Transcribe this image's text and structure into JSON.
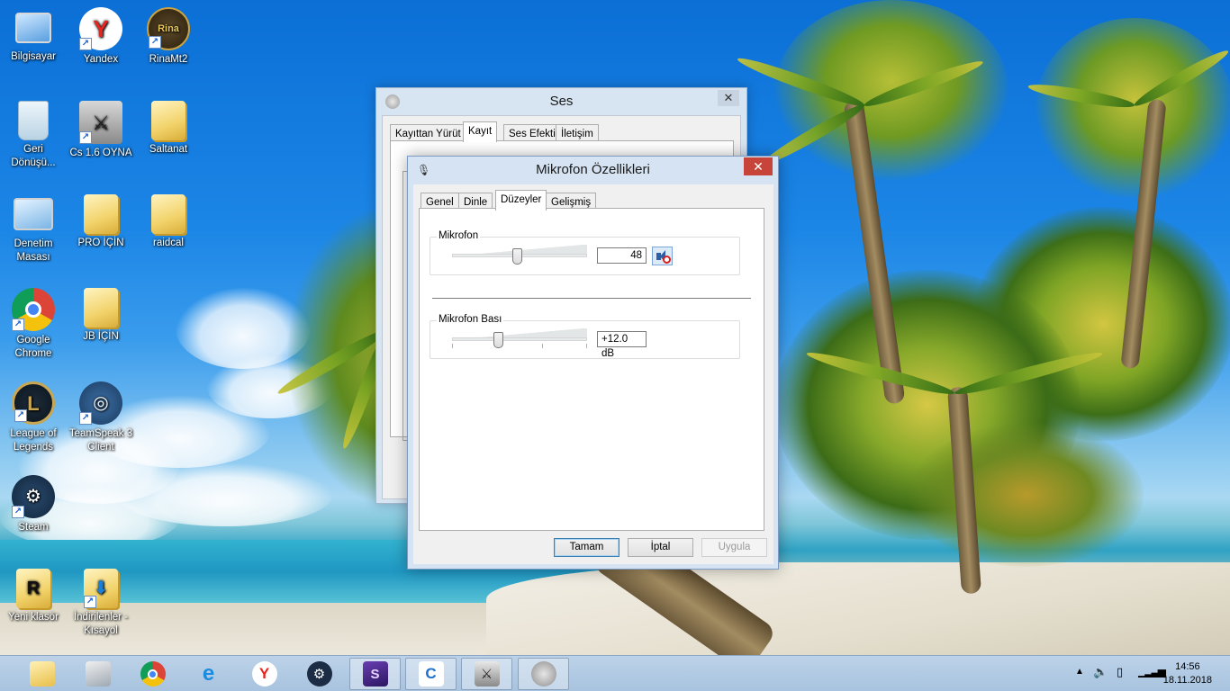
{
  "desktop": {
    "icons": [
      {
        "label": "Bilgisayar",
        "icon": "computer-icon"
      },
      {
        "label": "Yandex",
        "icon": "yandex-icon"
      },
      {
        "label": "RinaMt2",
        "icon": "rina-icon",
        "badge": "Rina"
      },
      {
        "label": "Geri Dönüşü...",
        "icon": "recycle-bin-icon"
      },
      {
        "label": "Cs 1.6 OYNA",
        "icon": "counter-strike-icon"
      },
      {
        "label": "Saltanat",
        "icon": "folder-icon"
      },
      {
        "label": "Denetim Masası",
        "icon": "control-panel-icon"
      },
      {
        "label": "PRO İÇİN",
        "icon": "folder-icon"
      },
      {
        "label": "raidcal",
        "icon": "folder-icon"
      },
      {
        "label": "Google Chrome",
        "icon": "chrome-icon"
      },
      {
        "label": "JB İÇİN",
        "icon": "folder-icon"
      },
      {
        "label": "League of Legends",
        "icon": "league-of-legends-icon"
      },
      {
        "label": "TeamSpeak 3 Client",
        "icon": "teamspeak-icon"
      },
      {
        "label": "Steam",
        "icon": "steam-icon"
      },
      {
        "label": "Yeni klasör",
        "icon": "folder-r-icon"
      },
      {
        "label": "İndirilenler - Kısayol",
        "icon": "downloads-folder-icon"
      }
    ]
  },
  "ses_window": {
    "title": "Ses",
    "close": "✕",
    "tabs": [
      "Kayıttan Yürüt",
      "Kayıt",
      "Ses Efekti",
      "İletişim"
    ],
    "active_tab": "Kayıt"
  },
  "mic_window": {
    "title": "Mikrofon Özellikleri",
    "close": "✕",
    "tabs": [
      "Genel",
      "Dinle",
      "Düzeyler",
      "Gelişmiş"
    ],
    "active_tab": "Düzeyler",
    "microphone": {
      "label": "Mikrofon",
      "value": "48",
      "level_percent": 48
    },
    "boost": {
      "label": "Mikrofon Bası",
      "value": "+12.0 dB",
      "level_percent": 33
    },
    "buttons": {
      "ok": "Tamam",
      "cancel": "İptal",
      "apply": "Uygula"
    }
  },
  "taskbar": {
    "apps": [
      "file-explorer-icon",
      "sound-device-icon",
      "chrome-icon",
      "internet-explorer-icon",
      "yandex-icon",
      "steam-icon",
      "rina-app-icon",
      "k-app-icon",
      "counter-strike-icon",
      "speaker-icon"
    ],
    "active_app": "speaker-icon",
    "clock": {
      "time": "14:56",
      "date": "18.11.2018"
    }
  }
}
